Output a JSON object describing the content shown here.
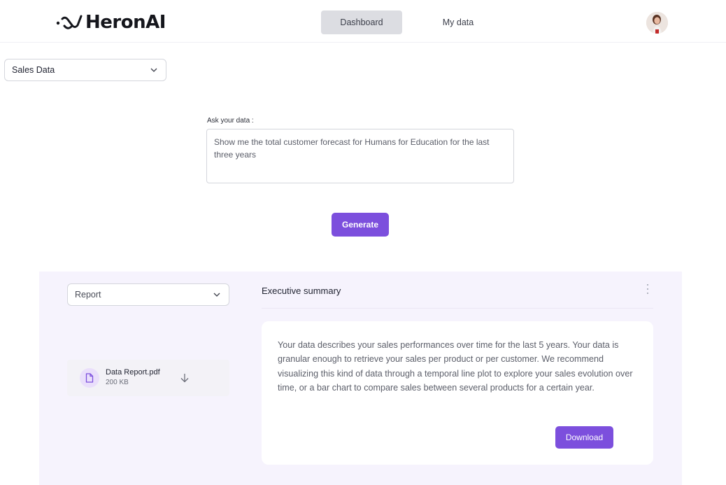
{
  "header": {
    "logo_text": "HeronAI",
    "nav": [
      {
        "label": "Dashboard",
        "active": true
      },
      {
        "label": "My data",
        "active": false
      }
    ]
  },
  "dataset_select": {
    "value": "Sales Data"
  },
  "ask": {
    "label": "Ask your data :",
    "value": "Show me the total customer forecast for Humans for Education for the last three years"
  },
  "generate_label": "Generate",
  "report": {
    "select_value": "Report",
    "file": {
      "name": "Data Report.pdf",
      "size": "200 KB"
    }
  },
  "summary": {
    "title": "Executive summary",
    "text": "Your data describes your sales performances over time for the last 5 years. Your data is granular enough to retrieve your sales per product or per customer. We recommend visualizing this kind of data through a temporal line plot to explore your sales evolution over time, or a bar chart to compare sales between several products for a certain year.",
    "download_label": "Download"
  },
  "colors": {
    "accent": "#7c4fdd",
    "panel_bg": "#f6f3fd",
    "active_tab_bg": "#dcdde2"
  },
  "icons": {
    "logo": "heron-logo-icon",
    "dropdown": "chevron-down-icon",
    "file": "file-icon",
    "download": "arrow-down-icon",
    "more": "kebab-menu-icon"
  }
}
